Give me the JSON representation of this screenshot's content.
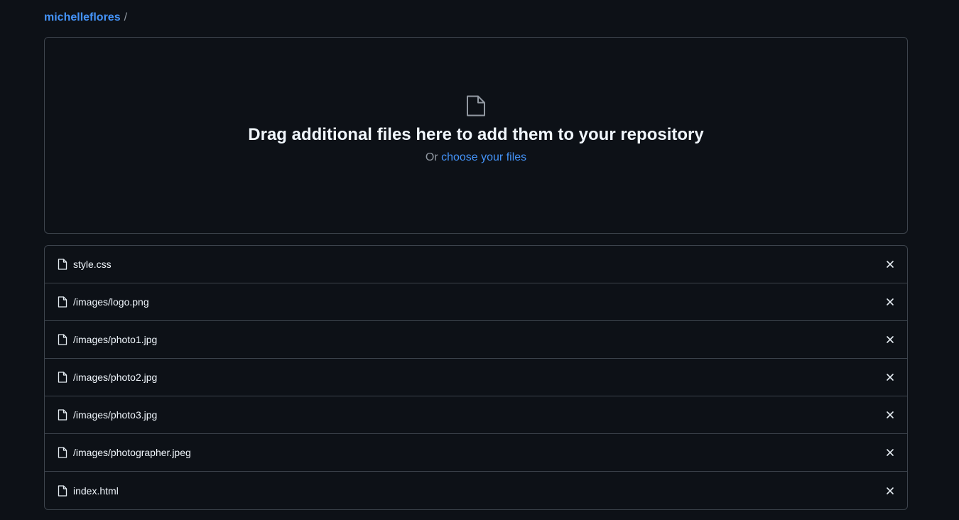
{
  "breadcrumb": {
    "owner": "michelleflores",
    "separator": "/"
  },
  "dropzone": {
    "icon": "file-icon",
    "title": "Drag additional files here to add them to your repository",
    "prefix": "Or",
    "link_label": "choose your files"
  },
  "files": [
    {
      "name": "style.css"
    },
    {
      "name": "/images/logo.png"
    },
    {
      "name": "/images/photo1.jpg"
    },
    {
      "name": "/images/photo2.jpg"
    },
    {
      "name": "/images/photo3.jpg"
    },
    {
      "name": "/images/photographer.jpeg"
    },
    {
      "name": "index.html"
    }
  ],
  "colors": {
    "background": "#0d1117",
    "border": "#3d444d",
    "link": "#4493f8",
    "text": "#f0f6fc",
    "muted": "#9198a1"
  }
}
